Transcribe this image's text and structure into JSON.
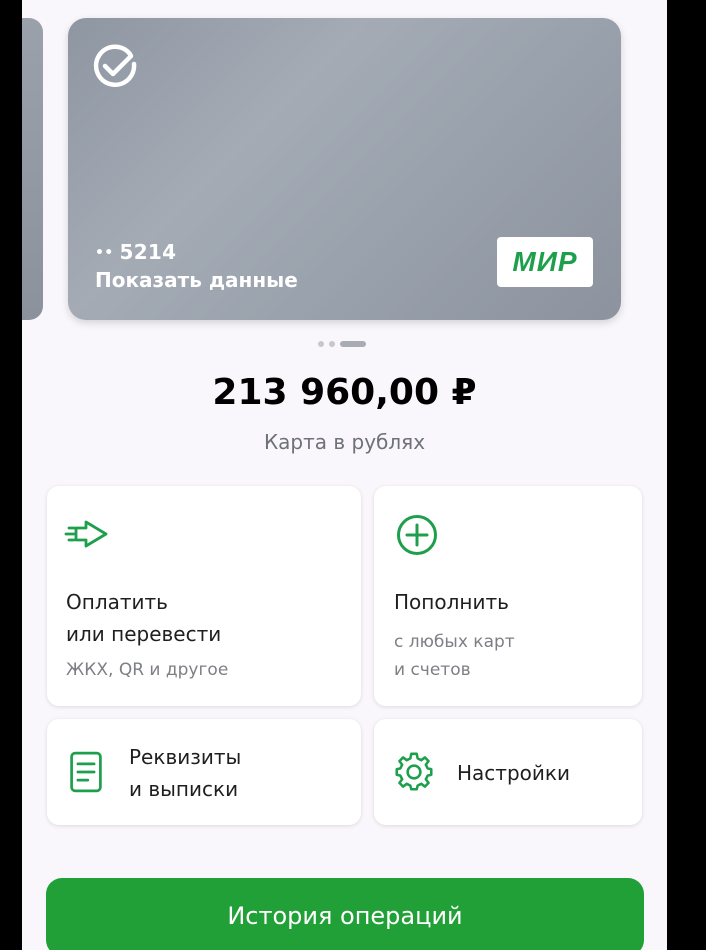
{
  "card": {
    "number_dots": "••",
    "number_last4": "5214",
    "show_data_label": "Показать данные",
    "payment_system": "МИР"
  },
  "pager": {
    "count": 3,
    "active_index": 2
  },
  "balance": {
    "amount": "213 960,00 ₽",
    "subtitle": "Карта в рублях"
  },
  "actions": {
    "pay": {
      "title_line1": "Оплатить",
      "title_line2": "или перевести",
      "subtitle": "ЖКХ, QR и другое",
      "icon": "transfer-arrow-icon"
    },
    "topup": {
      "title": "Пополнить",
      "subtitle_line1": "с любых карт",
      "subtitle_line2": "и счетов",
      "icon": "plus-circle-icon"
    },
    "details": {
      "title_line1": "Реквизиты",
      "title_line2": "и выписки",
      "icon": "document-icon"
    },
    "settings": {
      "title": "Настройки",
      "icon": "gear-icon"
    }
  },
  "history_button": {
    "label": "История операций"
  },
  "colors": {
    "accent_green": "#21a038",
    "icon_green": "#1e9f4c",
    "background": "#f9f7fb",
    "card_gray": "#9aa2ad"
  }
}
